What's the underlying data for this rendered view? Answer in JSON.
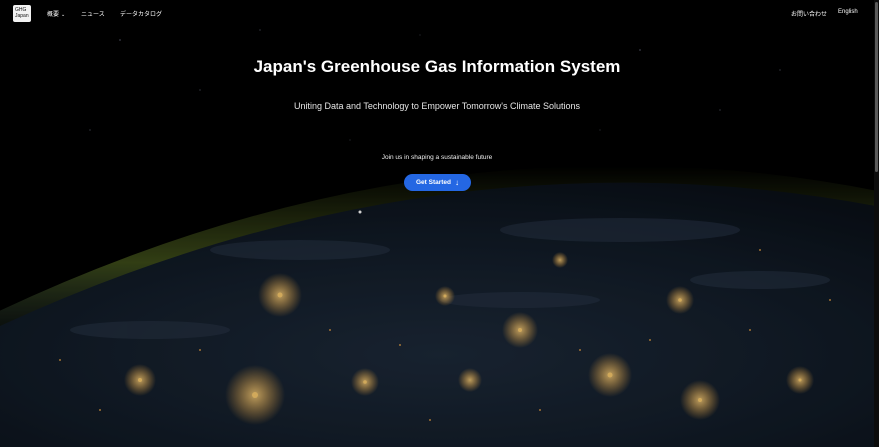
{
  "nav": {
    "logo_line1": "GHG",
    "logo_line2": "Japan",
    "overview": "概要",
    "news": "ニュース",
    "data_catalog": "データカタログ",
    "contact": "お問い合わせ",
    "language": "English"
  },
  "hero": {
    "title": "Japan's Greenhouse Gas Information System",
    "subtitle": "Uniting Data and Technology to Empower Tomorrow's Climate Solutions",
    "tagline": "Join us in shaping a sustainable future",
    "cta_label": "Get Started"
  },
  "icons": {
    "overview_chevron": "chevron-down-icon",
    "cta_arrow": "arrow-down-icon"
  },
  "colors": {
    "background": "#000000",
    "cta": "#2467e3",
    "city_lights": "#f5b84a",
    "atmosphere": "#7d8f3c"
  }
}
